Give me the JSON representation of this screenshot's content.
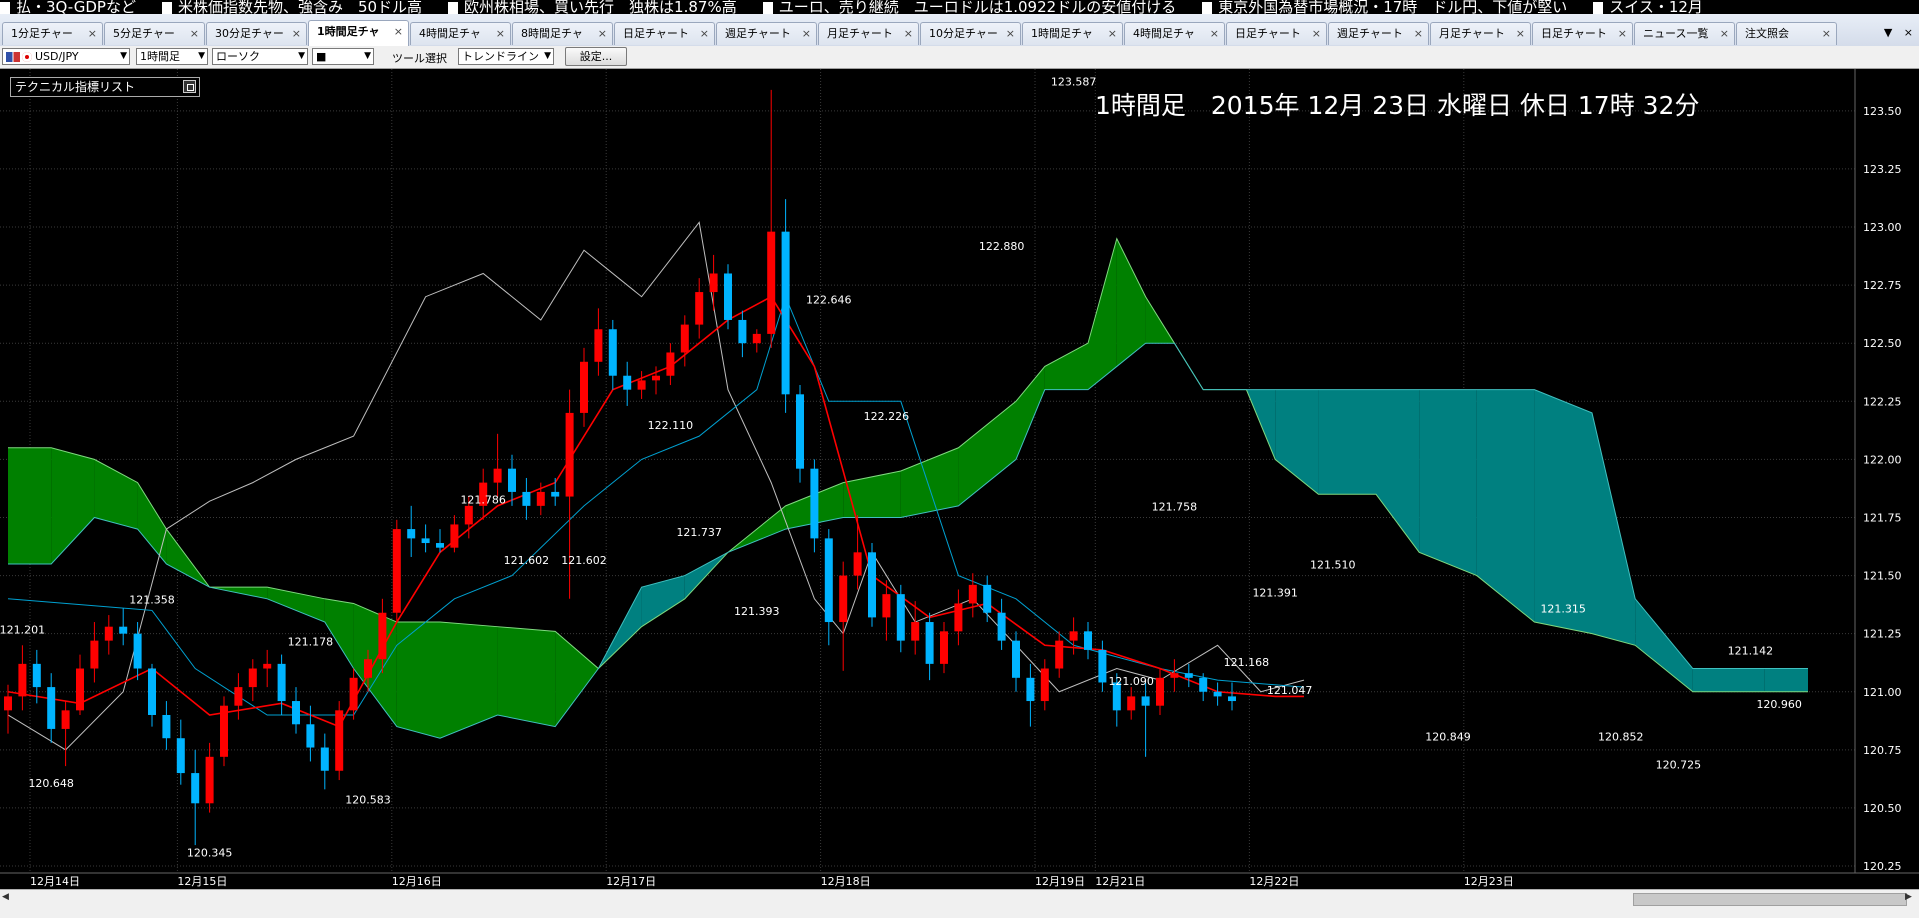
{
  "ticker": [
    "払・3Q-GDPなど",
    "米株価指数先物、強含み　50ドル高",
    "欧州株相場、買い先行　独株は1.87%高",
    "ユーロ、売り継続　ユーロドルは1.0922ドルの安値付ける",
    "東京外国為替市場概況・17時　ドル円、下値が堅い",
    "スイス・12月"
  ],
  "tabs": [
    {
      "label": "1分足チャー"
    },
    {
      "label": "5分足チャー"
    },
    {
      "label": "30分足チャー"
    },
    {
      "label": "1時間足チャ",
      "active": true
    },
    {
      "label": "4時間足チャ"
    },
    {
      "label": "8時間足チャ"
    },
    {
      "label": "日足チャート"
    },
    {
      "label": "週足チャート"
    },
    {
      "label": "月足チャート"
    },
    {
      "label": "10分足チャー"
    },
    {
      "label": "1時間足チャ"
    },
    {
      "label": "4時間足チャ"
    },
    {
      "label": "日足チャート"
    },
    {
      "label": "週足チャート"
    },
    {
      "label": "月足チャート"
    },
    {
      "label": "日足チャート"
    },
    {
      "label": "ニュース一覧"
    },
    {
      "label": "注文照会"
    }
  ],
  "tab_close": "×",
  "tab_controls": {
    "menu": "▼",
    "close": "×"
  },
  "toolbar": {
    "pair": "USD/JPY",
    "timeframe": "1時間足",
    "chart_style": "ローソク",
    "color": "■",
    "tool_label": "ツール選択",
    "tool": "トレンドライン",
    "settings": "設定..."
  },
  "indicator_list": "テクニカル指標リスト",
  "chart_data": {
    "type": "candlestick",
    "title": "1時間足　2015年 12月 23日 水曜日 休日 17時 32分",
    "ylim": [
      120.22,
      123.68
    ],
    "y_ticks": [
      "120.25",
      "120.50",
      "120.75",
      "121.00",
      "121.25",
      "121.50",
      "121.75",
      "122.00",
      "122.25",
      "122.50",
      "122.75",
      "123.00",
      "123.25",
      "123.50"
    ],
    "x_ticks": [
      {
        "label": "12月14日",
        "x": 0
      },
      {
        "label": "12月15日",
        "x": 11
      },
      {
        "label": "12月16日",
        "x": 27
      },
      {
        "label": "12月17日",
        "x": 43
      },
      {
        "label": "12月18日",
        "x": 59
      },
      {
        "label": "12月19日",
        "x": 75
      },
      {
        "label": "12月21日",
        "x": 79.5
      },
      {
        "label": "12月22日",
        "x": 91
      },
      {
        "label": "12月23日",
        "x": 107
      }
    ],
    "grid": true,
    "colors": {
      "up": "#ff0000",
      "down": "#00b4ff",
      "span_a_cloud": "#008000",
      "span_b_cloud": "#008080",
      "tenkan": "#ff0000",
      "kijun": "#00a0d0",
      "chikou": "#bfbfbf",
      "axis_text": "#ffffff"
    },
    "candles": [
      [
        120.92,
        121.03,
        120.82,
        120.98
      ],
      [
        120.98,
        121.2,
        120.92,
        121.12
      ],
      [
        121.12,
        121.18,
        120.95,
        121.02
      ],
      [
        121.02,
        121.08,
        120.78,
        120.84
      ],
      [
        120.84,
        120.96,
        120.68,
        120.92
      ],
      [
        120.92,
        121.16,
        120.9,
        121.1
      ],
      [
        121.1,
        121.3,
        121.04,
        121.22
      ],
      [
        121.22,
        121.33,
        121.16,
        121.28
      ],
      [
        121.28,
        121.36,
        121.2,
        121.25
      ],
      [
        121.25,
        121.3,
        121.05,
        121.1
      ],
      [
        121.1,
        121.12,
        120.85,
        120.9
      ],
      [
        120.9,
        120.96,
        120.75,
        120.8
      ],
      [
        120.8,
        120.88,
        120.6,
        120.65
      ],
      [
        120.65,
        120.75,
        120.34,
        120.52
      ],
      [
        120.52,
        120.78,
        120.48,
        120.72
      ],
      [
        120.72,
        120.98,
        120.68,
        120.94
      ],
      [
        120.94,
        121.08,
        120.88,
        121.02
      ],
      [
        121.02,
        121.14,
        120.96,
        121.1
      ],
      [
        121.1,
        121.18,
        121.02,
        121.12
      ],
      [
        121.12,
        121.16,
        120.9,
        120.96
      ],
      [
        120.96,
        121.02,
        120.82,
        120.86
      ],
      [
        120.86,
        120.94,
        120.7,
        120.76
      ],
      [
        120.76,
        120.82,
        120.58,
        120.66
      ],
      [
        120.66,
        120.96,
        120.62,
        120.92
      ],
      [
        120.92,
        121.1,
        120.88,
        121.06
      ],
      [
        121.06,
        121.18,
        121.0,
        121.14
      ],
      [
        121.14,
        121.4,
        121.08,
        121.34
      ],
      [
        121.34,
        121.74,
        121.3,
        121.7
      ],
      [
        121.7,
        121.8,
        121.58,
        121.66
      ],
      [
        121.66,
        121.72,
        121.6,
        121.64
      ],
      [
        121.64,
        121.7,
        121.6,
        121.62
      ],
      [
        121.62,
        121.76,
        121.6,
        121.72
      ],
      [
        121.72,
        121.84,
        121.66,
        121.8
      ],
      [
        121.8,
        121.96,
        121.74,
        121.9
      ],
      [
        121.9,
        122.11,
        121.84,
        121.96
      ],
      [
        121.96,
        122.02,
        121.8,
        121.86
      ],
      [
        121.86,
        121.92,
        121.74,
        121.8
      ],
      [
        121.8,
        121.9,
        121.76,
        121.86
      ],
      [
        121.86,
        121.92,
        121.8,
        121.84
      ],
      [
        121.84,
        122.3,
        121.4,
        122.2
      ],
      [
        122.2,
        122.48,
        122.14,
        122.42
      ],
      [
        122.42,
        122.65,
        122.36,
        122.56
      ],
      [
        122.56,
        122.6,
        122.3,
        122.36
      ],
      [
        122.36,
        122.42,
        122.23,
        122.3
      ],
      [
        122.3,
        122.38,
        122.26,
        122.34
      ],
      [
        122.34,
        122.4,
        122.28,
        122.36
      ],
      [
        122.36,
        122.5,
        122.32,
        122.46
      ],
      [
        122.46,
        122.62,
        122.4,
        122.58
      ],
      [
        122.58,
        122.78,
        122.52,
        122.72
      ],
      [
        122.72,
        122.88,
        122.64,
        122.8
      ],
      [
        122.8,
        122.84,
        122.56,
        122.6
      ],
      [
        122.6,
        122.64,
        122.44,
        122.5
      ],
      [
        122.5,
        122.56,
        122.46,
        122.54
      ],
      [
        122.54,
        123.59,
        122.48,
        122.98
      ],
      [
        122.98,
        123.12,
        122.2,
        122.28
      ],
      [
        122.28,
        122.32,
        121.9,
        121.96
      ],
      [
        121.96,
        122.0,
        121.6,
        121.66
      ],
      [
        121.66,
        121.7,
        121.2,
        121.3
      ],
      [
        121.3,
        121.56,
        121.09,
        121.5
      ],
      [
        121.5,
        121.76,
        121.44,
        121.6
      ],
      [
        121.6,
        121.64,
        121.28,
        121.32
      ],
      [
        121.32,
        121.48,
        121.22,
        121.42
      ],
      [
        121.42,
        121.46,
        121.17,
        121.22
      ],
      [
        121.22,
        121.39,
        121.16,
        121.3
      ],
      [
        121.3,
        121.34,
        121.05,
        121.12
      ],
      [
        121.12,
        121.3,
        121.08,
        121.26
      ],
      [
        121.26,
        121.44,
        121.2,
        121.38
      ],
      [
        121.38,
        121.51,
        121.32,
        121.46
      ],
      [
        121.46,
        121.5,
        121.3,
        121.34
      ],
      [
        121.34,
        121.4,
        121.18,
        121.22
      ],
      [
        121.22,
        121.26,
        121.0,
        121.06
      ],
      [
        121.06,
        121.12,
        120.85,
        120.96
      ],
      [
        120.96,
        121.14,
        120.92,
        121.1
      ],
      [
        121.1,
        121.26,
        121.06,
        121.22
      ],
      [
        121.22,
        121.32,
        121.16,
        121.26
      ],
      [
        121.26,
        121.3,
        121.14,
        121.18
      ],
      [
        121.18,
        121.22,
        121.0,
        121.04
      ],
      [
        121.04,
        121.08,
        120.85,
        120.92
      ],
      [
        120.92,
        121.02,
        120.88,
        120.98
      ],
      [
        120.98,
        121.04,
        120.72,
        120.94
      ],
      [
        120.94,
        121.1,
        120.9,
        121.06
      ],
      [
        121.06,
        121.14,
        121.0,
        121.08
      ],
      [
        121.08,
        121.12,
        121.02,
        121.06
      ],
      [
        121.06,
        121.08,
        120.96,
        121.0
      ],
      [
        121.0,
        121.04,
        120.94,
        120.98
      ],
      [
        120.98,
        121.04,
        120.92,
        120.96
      ]
    ],
    "tenkan": [
      [
        0,
        121.0
      ],
      [
        5,
        120.95
      ],
      [
        10,
        121.1
      ],
      [
        14,
        120.9
      ],
      [
        19,
        120.95
      ],
      [
        23,
        120.85
      ],
      [
        27,
        121.3
      ],
      [
        30,
        121.6
      ],
      [
        34,
        121.8
      ],
      [
        38,
        121.9
      ],
      [
        42,
        122.3
      ],
      [
        46,
        122.4
      ],
      [
        50,
        122.6
      ],
      [
        53,
        122.7
      ],
      [
        56,
        122.4
      ],
      [
        60,
        121.5
      ],
      [
        64,
        121.32
      ],
      [
        68,
        121.38
      ],
      [
        72,
        121.2
      ],
      [
        76,
        121.18
      ],
      [
        80,
        121.1
      ],
      [
        84,
        121.0
      ],
      [
        88,
        120.98
      ],
      [
        90,
        120.98
      ]
    ],
    "kijun": [
      [
        0,
        121.4
      ],
      [
        10,
        121.35
      ],
      [
        13,
        121.1
      ],
      [
        18,
        120.9
      ],
      [
        24,
        120.9
      ],
      [
        27,
        121.2
      ],
      [
        31,
        121.4
      ],
      [
        35,
        121.5
      ],
      [
        40,
        121.8
      ],
      [
        44,
        122.0
      ],
      [
        48,
        122.1
      ],
      [
        52,
        122.3
      ],
      [
        54,
        122.7
      ],
      [
        57,
        122.25
      ],
      [
        62,
        122.25
      ],
      [
        66,
        121.5
      ],
      [
        70,
        121.4
      ],
      [
        74,
        121.2
      ],
      [
        80,
        121.1
      ],
      [
        84,
        121.05
      ],
      [
        90,
        121.02
      ]
    ],
    "chikou": [
      [
        0,
        120.9
      ],
      [
        4,
        120.75
      ],
      [
        8,
        121.0
      ],
      [
        11,
        121.7
      ],
      [
        14,
        121.82
      ],
      [
        17,
        121.9
      ],
      [
        20,
        122.0
      ],
      [
        24,
        122.1
      ],
      [
        29,
        122.7
      ],
      [
        33,
        122.8
      ],
      [
        37,
        122.6
      ],
      [
        40,
        122.9
      ],
      [
        44,
        122.7
      ],
      [
        48,
        123.02
      ],
      [
        50,
        122.3
      ],
      [
        53,
        121.9
      ],
      [
        56,
        121.4
      ],
      [
        58,
        121.25
      ],
      [
        60,
        121.6
      ],
      [
        63,
        121.3
      ],
      [
        67,
        121.4
      ],
      [
        70,
        121.2
      ],
      [
        73,
        121.0
      ],
      [
        77,
        121.1
      ],
      [
        80,
        121.05
      ],
      [
        84,
        121.2
      ],
      [
        87,
        121.0
      ],
      [
        90,
        121.05
      ]
    ],
    "cloud": [
      [
        0,
        122.05,
        121.55
      ],
      [
        3,
        122.05,
        121.55
      ],
      [
        6,
        122.0,
        121.75
      ],
      [
        9,
        121.9,
        121.7
      ],
      [
        11,
        121.7,
        121.55
      ],
      [
        14,
        121.45,
        121.45
      ],
      [
        18,
        121.45,
        121.4
      ],
      [
        22,
        121.4,
        121.3
      ],
      [
        24,
        121.38,
        121.1
      ],
      [
        27,
        121.3,
        120.85
      ],
      [
        30,
        121.3,
        120.8
      ],
      [
        34,
        121.28,
        120.9
      ],
      [
        38,
        121.26,
        120.85
      ],
      [
        41,
        121.1,
        121.1
      ],
      [
        44,
        121.28,
        121.45
      ],
      [
        47,
        121.4,
        121.5
      ],
      [
        50,
        121.6,
        121.6
      ],
      [
        54,
        121.8,
        121.7
      ],
      [
        58,
        121.9,
        121.75
      ],
      [
        62,
        121.95,
        121.75
      ],
      [
        66,
        122.05,
        121.8
      ],
      [
        70,
        122.25,
        122.0
      ],
      [
        72,
        122.4,
        122.3
      ],
      [
        75,
        122.5,
        122.3
      ],
      [
        77,
        122.95,
        122.4
      ],
      [
        79,
        122.7,
        122.5
      ],
      [
        81,
        122.5,
        122.5
      ],
      [
        83,
        122.3,
        122.3
      ],
      [
        86,
        122.3,
        122.3
      ],
      [
        88,
        122.0,
        122.3
      ],
      [
        91,
        121.85,
        122.3
      ],
      [
        95,
        121.85,
        122.3
      ],
      [
        98,
        121.6,
        122.3
      ],
      [
        102,
        121.5,
        122.3
      ],
      [
        106,
        121.3,
        122.3
      ],
      [
        110,
        121.25,
        122.2
      ],
      [
        113,
        121.2,
        121.4
      ],
      [
        117,
        121.0,
        121.1
      ],
      [
        122,
        121.0,
        121.1
      ],
      [
        125,
        121.0,
        121.1
      ]
    ],
    "labels": [
      {
        "text": "121.201",
        "i": 1,
        "y": 121.25
      },
      {
        "text": "121.358",
        "i": 10,
        "y": 121.38
      },
      {
        "text": "120.648",
        "i": 3,
        "y": 120.59
      },
      {
        "text": "120.345",
        "i": 14,
        "y": 120.29
      },
      {
        "text": "121.178",
        "i": 21,
        "y": 121.2
      },
      {
        "text": "120.583",
        "i": 25,
        "y": 120.52
      },
      {
        "text": "121.786",
        "i": 33,
        "y": 121.81
      },
      {
        "text": "121.602",
        "i": 36,
        "y": 121.55
      },
      {
        "text": "121.602",
        "i": 40,
        "y": 121.55
      },
      {
        "text": "122.110",
        "i": 46,
        "y": 122.13
      },
      {
        "text": "121.737",
        "i": 48,
        "y": 121.67
      },
      {
        "text": "121.393",
        "i": 52,
        "y": 121.33
      },
      {
        "text": "122.646",
        "i": 57,
        "y": 122.67
      },
      {
        "text": "122.226",
        "i": 61,
        "y": 122.17
      },
      {
        "text": "122.880",
        "i": 69,
        "y": 122.9
      },
      {
        "text": "123.587",
        "i": 74,
        "y": 123.61
      },
      {
        "text": "121.758",
        "i": 81,
        "y": 121.78
      },
      {
        "text": "121.090",
        "i": 78,
        "y": 121.03
      },
      {
        "text": "121.391",
        "i": 88,
        "y": 121.41
      },
      {
        "text": "121.168",
        "i": 86,
        "y": 121.11
      },
      {
        "text": "121.510",
        "i": 92,
        "y": 121.53
      },
      {
        "text": "121.047",
        "i": 89,
        "y": 120.99
      },
      {
        "text": "120.849",
        "i": 100,
        "y": 120.79
      },
      {
        "text": "121.315",
        "i": 108,
        "y": 121.34
      },
      {
        "text": "120.852",
        "i": 112,
        "y": 120.79
      },
      {
        "text": "120.725",
        "i": 116,
        "y": 120.67
      },
      {
        "text": "121.142",
        "i": 121,
        "y": 121.16
      },
      {
        "text": "120.960",
        "i": 123,
        "y": 120.93
      }
    ]
  }
}
